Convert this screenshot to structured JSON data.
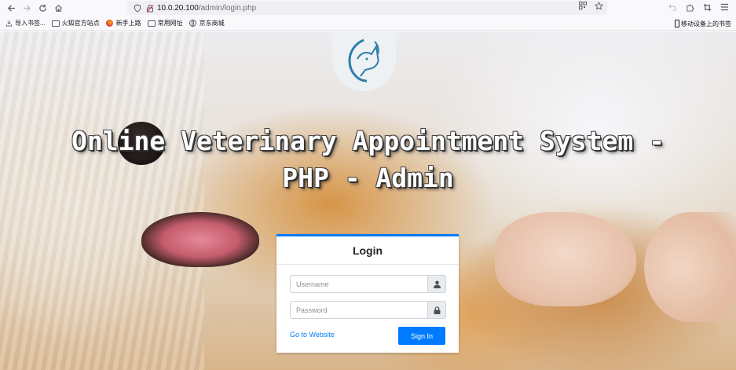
{
  "browser": {
    "url_host": "10.0.20.100",
    "url_path": "/admin/login.php",
    "icons": {
      "back": "arrow-left-icon",
      "forward": "arrow-right-icon",
      "reload": "reload-icon",
      "home": "home-icon",
      "shield": "shield-icon",
      "lock": "lock-warning-icon",
      "qr": "qr-code-icon",
      "star": "star-icon",
      "undo": "undo-icon",
      "extensions": "puzzle-icon",
      "screenshot": "crop-icon",
      "menu": "menu-icon"
    }
  },
  "bookmarks": {
    "items": [
      {
        "label": "导入书签...",
        "icon": "import-icon"
      },
      {
        "label": "火狐官方站点",
        "icon": "folder-icon"
      },
      {
        "label": "新手上路",
        "icon": "firefox-icon"
      },
      {
        "label": "常用网址",
        "icon": "folder-icon"
      },
      {
        "label": "京东商城",
        "icon": "globe-icon"
      }
    ],
    "mobile_label": "移动设备上的书签"
  },
  "page": {
    "title_line1": "Online Veterinary Appointment System -",
    "title_line2": "PHP - Admin",
    "logo_icon": "vet-dog-logo-icon"
  },
  "login": {
    "heading": "Login",
    "username_placeholder": "Username",
    "password_placeholder": "Password",
    "username_icon": "user-icon",
    "password_icon": "lock-icon",
    "go_to_website": "Go to Website",
    "sign_in": "Sign In"
  },
  "colors": {
    "primary": "#007bff",
    "title_text": "#ffffff"
  }
}
